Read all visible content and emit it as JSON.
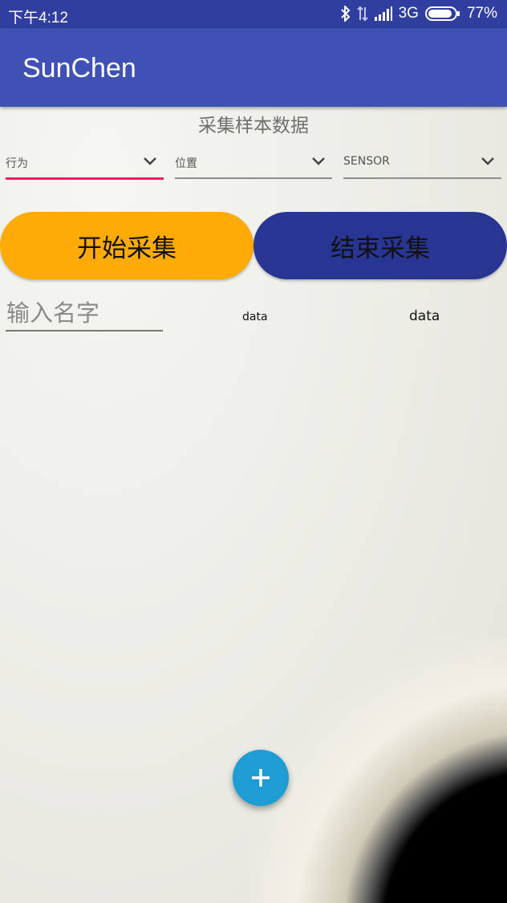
{
  "status_bar": {
    "time": "下午4:12",
    "network": "3G",
    "battery": "77%",
    "icons": [
      "bluetooth-icon",
      "data-transfer-icon",
      "signal-icon",
      "battery-icon"
    ]
  },
  "app_bar": {
    "title": "SunChen"
  },
  "main": {
    "heading": "采集样本数据",
    "spinners": [
      {
        "label": "行为",
        "active": true
      },
      {
        "label": "位置",
        "active": false
      },
      {
        "label": "SENSOR",
        "active": false
      }
    ],
    "start_button": "开始采集",
    "stop_button": "结束采集",
    "name_input": {
      "placeholder": "输入名字",
      "value": ""
    },
    "data_left": "data",
    "data_right": "data"
  },
  "fab": {
    "icon": "plus-icon"
  },
  "colors": {
    "status_bar": "#303F9F",
    "app_bar": "#3F51B5",
    "accent": "#E91E63",
    "start_button": "#FFAB07",
    "stop_button": "#283593",
    "fab": "#1E9DD4"
  }
}
